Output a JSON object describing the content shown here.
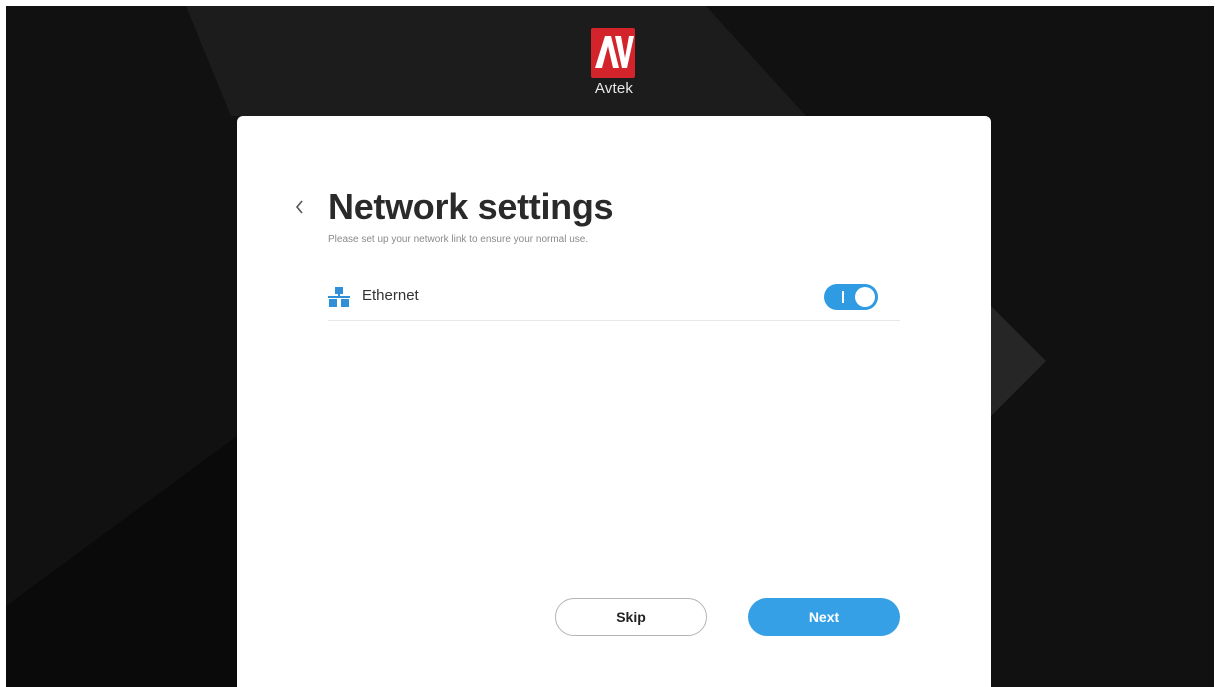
{
  "brand": {
    "logo_letters": "AV",
    "name": "Avtek"
  },
  "page": {
    "back_icon": "chevron-left-icon",
    "title": "Network settings",
    "subtitle": "Please set up your network link to ensure your normal use."
  },
  "network": {
    "items": [
      {
        "icon": "ethernet-icon",
        "label": "Ethernet",
        "enabled": true
      }
    ]
  },
  "actions": {
    "skip_label": "Skip",
    "next_label": "Next"
  },
  "colors": {
    "accent": "#36a0e6",
    "toggle_on": "#2f9be3",
    "logo_red": "#d3242b",
    "background": "#0d0d0d"
  }
}
